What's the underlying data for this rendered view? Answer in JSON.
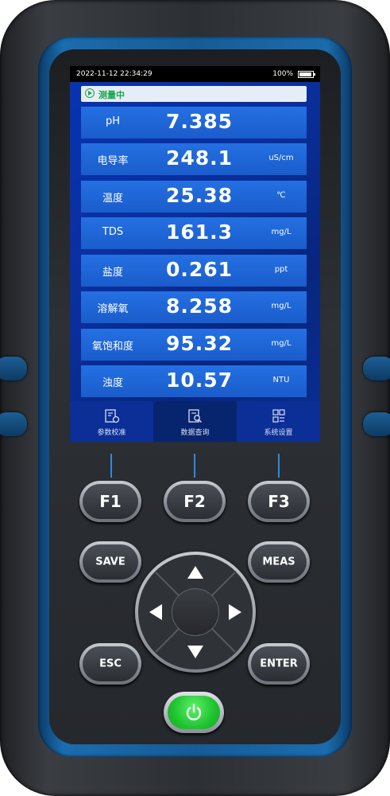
{
  "status_bar": {
    "datetime": "2022-11-12  22:34:29",
    "battery_percent": "100%",
    "battery_level": 1.0
  },
  "mode": {
    "label": "测量中",
    "icon": "play-circle-icon"
  },
  "readings": [
    {
      "name": "pH",
      "value": "7.385",
      "unit": ""
    },
    {
      "name": "电导率",
      "value": "248.1",
      "unit": "uS/cm"
    },
    {
      "name": "温度",
      "value": "25.38",
      "unit": "℃"
    },
    {
      "name": "TDS",
      "value": "161.3",
      "unit": "mg/L"
    },
    {
      "name": "盐度",
      "value": "0.261",
      "unit": "ppt"
    },
    {
      "name": "溶解氧",
      "value": "8.258",
      "unit": "mg/L"
    },
    {
      "name": "氧饱和度",
      "value": "95.32",
      "unit": "mg/L"
    },
    {
      "name": "浊度",
      "value": "10.57",
      "unit": "NTU"
    }
  ],
  "nav": [
    {
      "label": "参数校准",
      "icon": "calibration-icon",
      "active": false
    },
    {
      "label": "数据查询",
      "icon": "data-query-icon",
      "active": true
    },
    {
      "label": "系统设置",
      "icon": "grid-settings-icon",
      "active": false
    }
  ],
  "keys": {
    "f1": "F1",
    "f2": "F2",
    "f3": "F3",
    "save": "SAVE",
    "meas": "MEAS",
    "esc": "ESC",
    "enter": "ENTER"
  },
  "colors": {
    "screen_bg": "#0a2a8c",
    "row_bg": "#1f66d8",
    "accent_green": "#1aa64a",
    "frame_blue": "#155c97"
  }
}
